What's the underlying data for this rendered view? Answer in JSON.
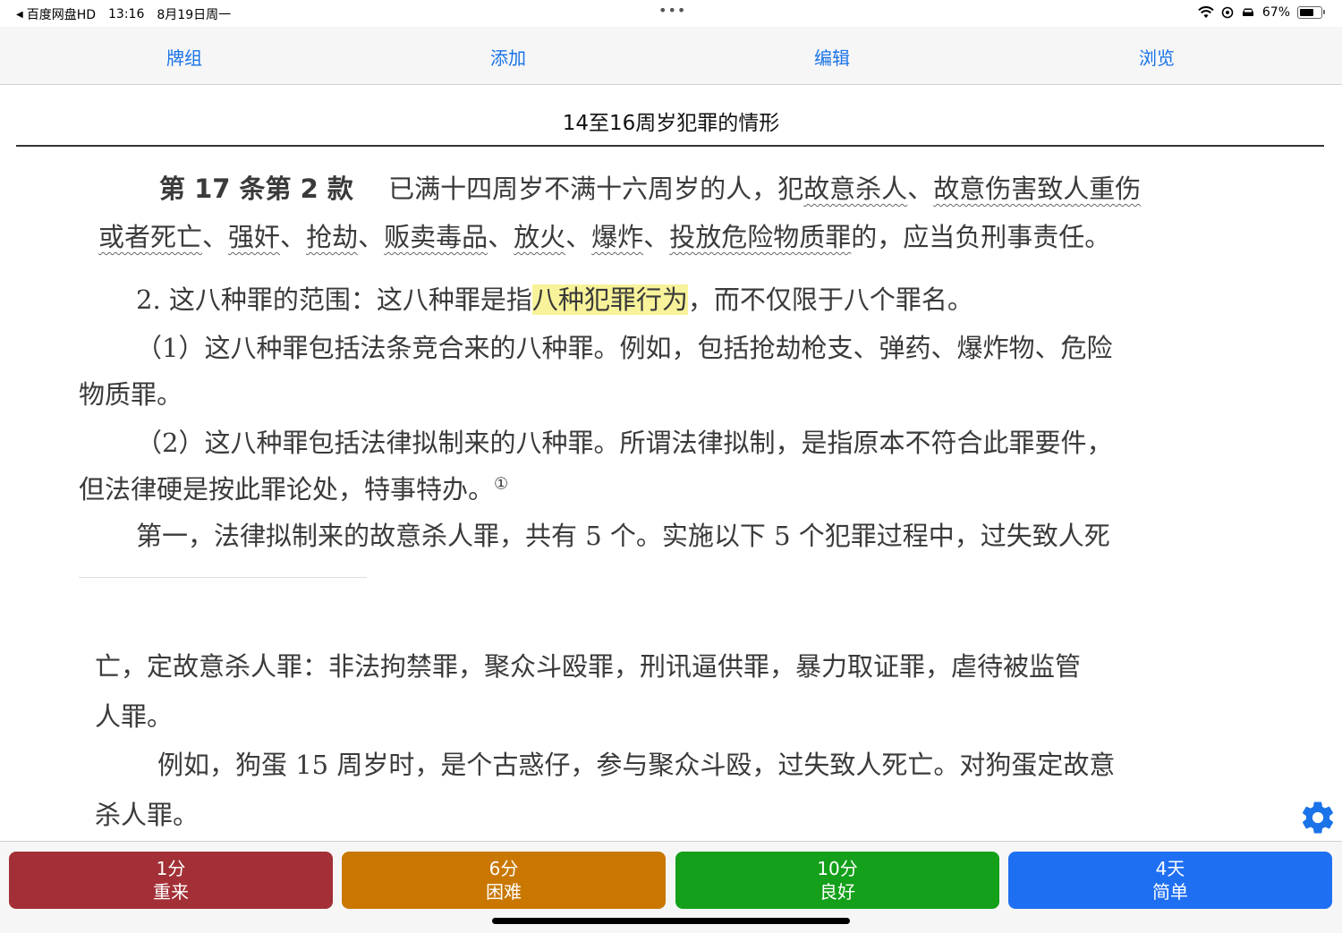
{
  "status_bar": {
    "back_app": "百度网盘HD",
    "time": "13:16",
    "date": "8月19日周一",
    "battery_text": "67%",
    "battery_level": 0.67,
    "icons": [
      "back-triangle-icon",
      "wifi-icon",
      "location-icon",
      "car-icon",
      "battery-icon"
    ]
  },
  "nav": {
    "decks": "牌组",
    "add": "添加",
    "edit": "编辑",
    "browse": "浏览"
  },
  "card": {
    "title": "14至16周岁犯罪的情形",
    "lines": {
      "l1_bold": "第 17 条第 2 款",
      "l1_text": "已满十四周岁不满十六周岁的人，犯",
      "l1_u1": "故意杀人",
      "l1_sep": "、",
      "l1_u2": "故意伤害致人重伤",
      "l2_u1": "或者死亡",
      "l2_s1": "、",
      "l2_u2": "强奸",
      "l2_s2": "、",
      "l2_u3": "抢劫",
      "l2_s3": "、",
      "l2_u4": "贩卖毒品",
      "l2_s4": "、",
      "l2_u5": "放火",
      "l2_s5": "、",
      "l2_u6": "爆炸",
      "l2_s6": "、",
      "l2_u7": "投放危险物质罪",
      "l2_end": "的，应当负刑事责任。",
      "l3_a": "2. 这八种罪的范围：这八种罪是指",
      "l3_hl": "八种犯罪行为",
      "l3_b": "，而不仅限于八个罪名。",
      "l4": "（1）这八种罪包括法条竞合来的八种罪。例如，包括抢劫枪支、弹药、爆炸物、危险",
      "l5": "物质罪。",
      "l6": "（2）这八种罪包括法律拟制来的八种罪。所谓法律拟制，是指原本不符合此罪要件，",
      "l7": "但法律硬是按此罪论处，特事特办。",
      "l7_note": "①",
      "l8": "第一，法律拟制来的故意杀人罪，共有 5 个。实施以下 5 个犯罪过程中，过失致人死",
      "l9": "亡，定故意杀人罪：非法拘禁罪，聚众斗殴罪，刑讯逼供罪，暴力取证罪，虐待被监管",
      "l10": "人罪。",
      "l11": "例如，狗蛋 15 周岁时，是个古惑仔，参与聚众斗殴，过失致人死亡。对狗蛋定故意",
      "l12": "杀人罪。"
    }
  },
  "answers": [
    {
      "interval": "1分",
      "label": "重来",
      "color": "#a33036"
    },
    {
      "interval": "6分",
      "label": "困难",
      "color": "#c97700"
    },
    {
      "interval": "10分",
      "label": "良好",
      "color": "#14a01a"
    },
    {
      "interval": "4天",
      "label": "简单",
      "color": "#1f6ff2"
    }
  ],
  "settings_icon": "gear-icon"
}
